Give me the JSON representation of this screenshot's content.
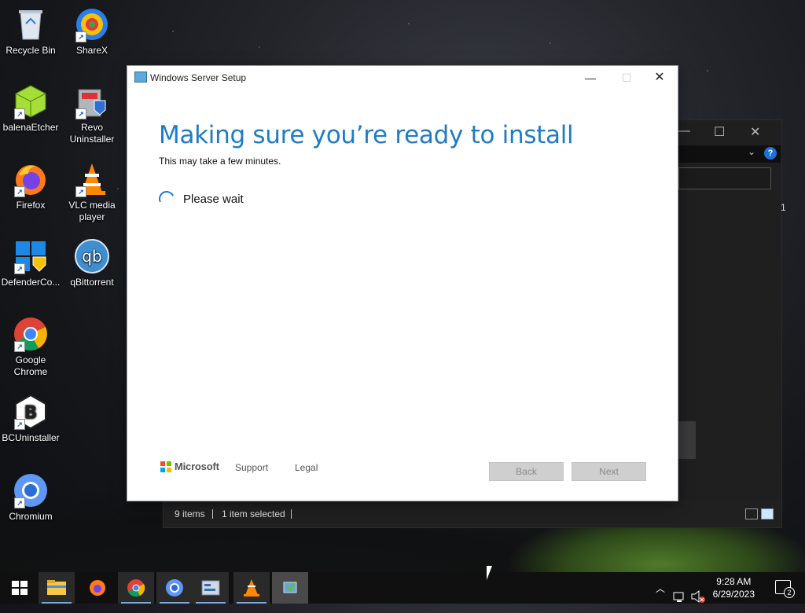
{
  "desktop": {
    "icons": [
      {
        "label": "Recycle Bin",
        "icon": "recycle-bin-icon"
      },
      {
        "label": "ShareX",
        "icon": "sharex-icon"
      },
      {
        "label": "balenaEtcher",
        "icon": "balenaetcher-icon"
      },
      {
        "label": "Revo Uninstaller",
        "icon": "revo-uninstaller-icon"
      },
      {
        "label": "Firefox",
        "icon": "firefox-icon"
      },
      {
        "label": "VLC media player",
        "icon": "vlc-icon"
      },
      {
        "label": "DefenderCo...",
        "icon": "defender-control-icon"
      },
      {
        "label": "qBittorrent",
        "icon": "qbittorrent-icon"
      },
      {
        "label": "Google Chrome",
        "icon": "chrome-icon"
      },
      {
        "label": "BCUninstaller",
        "icon": "bcuninstaller-icon"
      },
      {
        "label": "Chromium",
        "icon": "chromium-icon"
      }
    ]
  },
  "explorer": {
    "status_items": "9 items",
    "status_selected": "1 item selected",
    "count_glyph": "1",
    "help_glyph": "?"
  },
  "setup": {
    "title": "Windows Server Setup",
    "heading": "Making sure you’re ready to install",
    "subtitle": "This may take a few minutes.",
    "status": "Please wait",
    "brand": "Microsoft",
    "support_link": "Support",
    "legal_link": "Legal",
    "back_button": "Back",
    "next_button": "Next",
    "brand_colors": [
      "#f25022",
      "#7fba00",
      "#00a4ef",
      "#ffb900"
    ],
    "accent": "#1e7bc8"
  },
  "taskbar": {
    "apps": [
      "start-icon",
      "file-explorer-icon",
      "firefox-icon",
      "chrome-icon",
      "chromium-icon",
      "control-panel-icon",
      "vlc-icon",
      "setup-icon"
    ],
    "time": "9:28 AM",
    "date": "6/29/2023",
    "notification_count": "2"
  }
}
